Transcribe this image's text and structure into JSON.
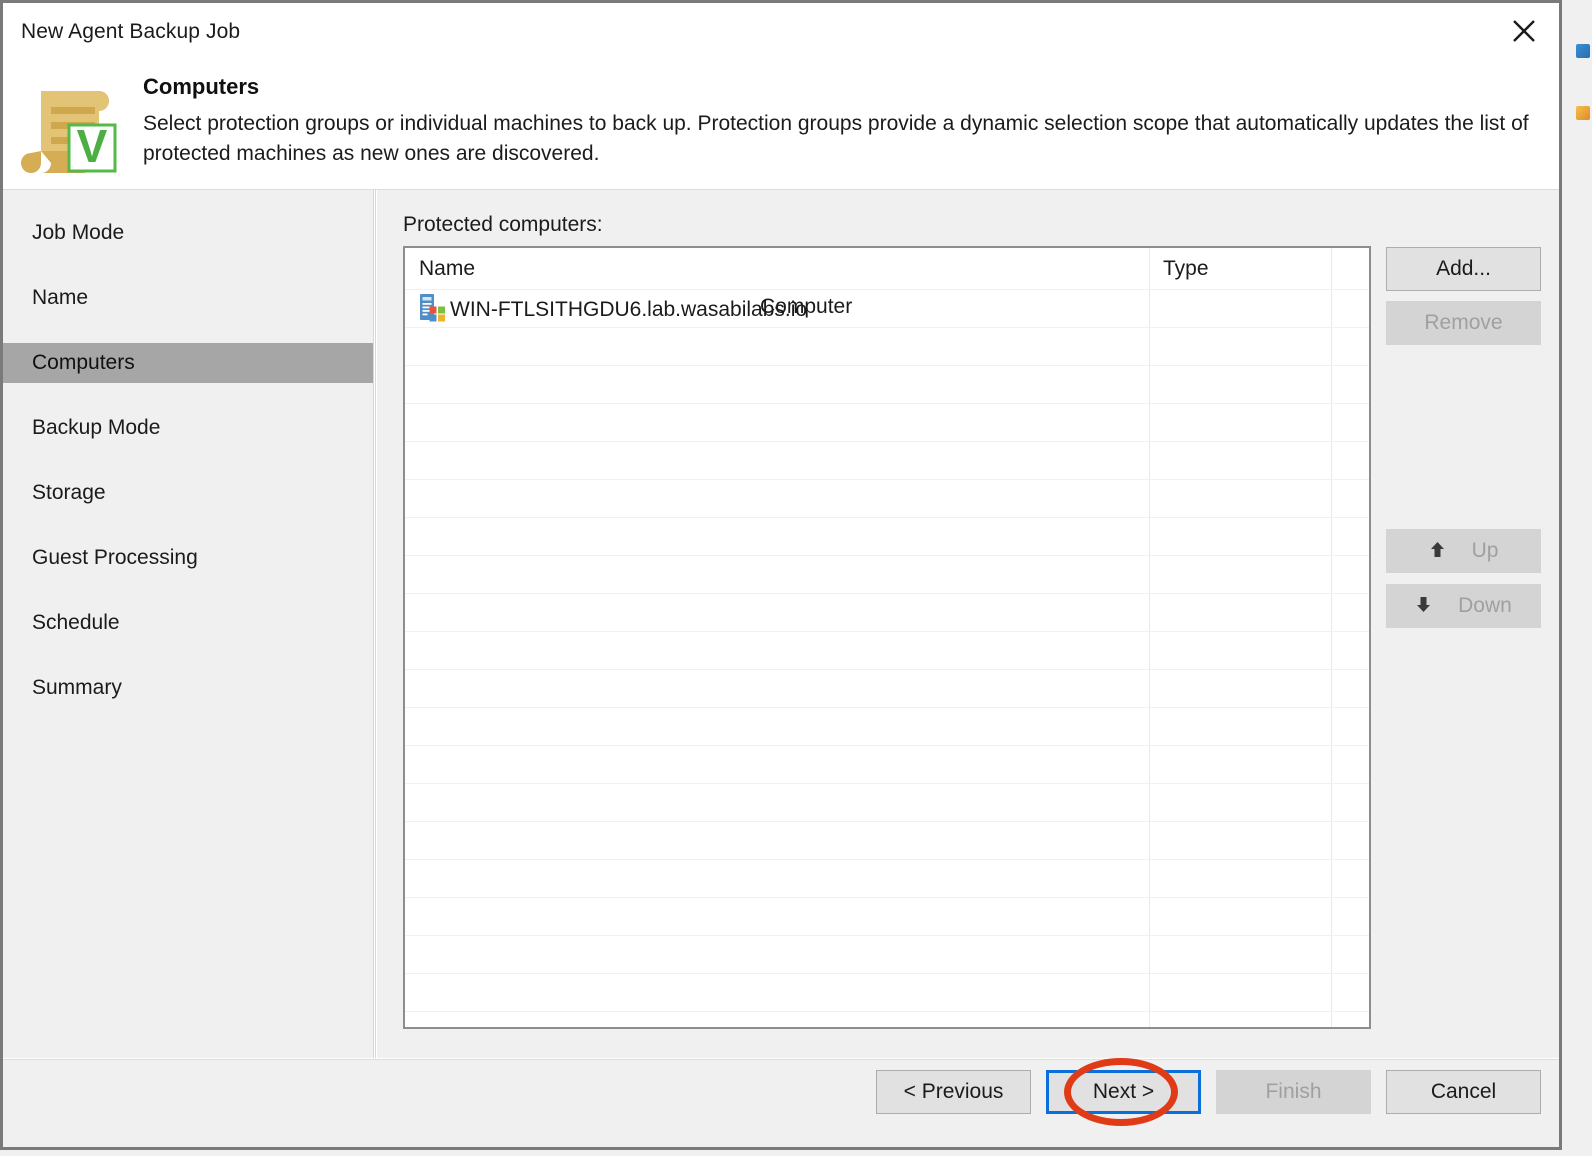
{
  "window": {
    "title": "New Agent Backup Job",
    "close_icon": "close-icon"
  },
  "header": {
    "icon": "scroll-veeam-badge-icon",
    "title": "Computers",
    "description": "Select protection groups or individual machines to back up. Protection groups provide a dynamic selection scope that automatically updates the list of protected machines as new ones are discovered."
  },
  "sidebar": {
    "items": [
      {
        "label": "Job Mode",
        "active": false
      },
      {
        "label": "Name",
        "active": false
      },
      {
        "label": "Computers",
        "active": true
      },
      {
        "label": "Backup Mode",
        "active": false
      },
      {
        "label": "Storage",
        "active": false
      },
      {
        "label": "Guest Processing",
        "active": false
      },
      {
        "label": "Schedule",
        "active": false
      },
      {
        "label": "Summary",
        "active": false
      }
    ]
  },
  "main": {
    "list_label": "Protected computers:",
    "table": {
      "columns": [
        "Name",
        "Type"
      ],
      "rows": [
        {
          "icon": "server-windows-icon",
          "name": "WIN-FTLSITHGDU6.lab.wasabilabs.io",
          "type": "Computer"
        }
      ]
    },
    "side_buttons": [
      {
        "label": "Add...",
        "state": "enabled",
        "icon": null
      },
      {
        "label": "Remove",
        "state": "disabled",
        "icon": null
      },
      {
        "label": "Up",
        "state": "disabled",
        "icon": "arrow-up-icon",
        "glyph": "↑"
      },
      {
        "label": "Down",
        "state": "disabled",
        "icon": "arrow-down-icon",
        "glyph": "↓"
      }
    ]
  },
  "footer": {
    "buttons": [
      {
        "label": "< Previous",
        "state": "enabled",
        "focused": false
      },
      {
        "label": "Next >",
        "state": "enabled",
        "focused": true
      },
      {
        "label": "Finish",
        "state": "disabled",
        "focused": false
      },
      {
        "label": "Cancel",
        "state": "enabled",
        "focused": false
      }
    ]
  },
  "annotation": {
    "shape": "ellipse",
    "color": "#e03b17",
    "target": "Next >"
  },
  "colors": {
    "accent_focus": "#0a6fd8",
    "selection": "#a6a6a6",
    "panel": "#f0f0f0",
    "annotation": "#e03b17",
    "veeam_green": "#54b948"
  }
}
